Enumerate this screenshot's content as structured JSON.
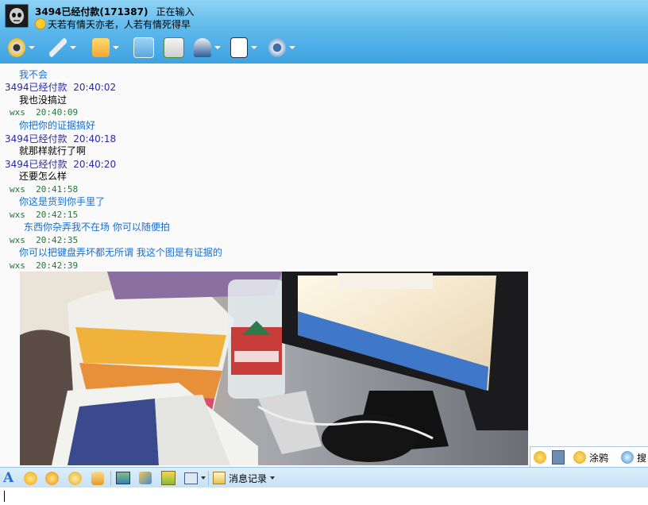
{
  "header": {
    "contact_name": "3494已经付款(171387)",
    "status": "正在输入",
    "signature": "天若有情天亦老，人若有情死得早"
  },
  "toolbar": {
    "icons": [
      "webcam-icon",
      "microphone-icon",
      "folder-transfer-icon",
      "email-icon",
      "add-contact-icon",
      "user-info-icon",
      "game-card-icon",
      "settings-icon"
    ]
  },
  "messages": [
    {
      "type": "text",
      "style": "blue",
      "text": "我不会"
    },
    {
      "type": "header",
      "sender": "3494已经付款",
      "time": "20:40:02"
    },
    {
      "type": "text",
      "style": "black",
      "text": "我也没搞过"
    },
    {
      "type": "header",
      "sender": "wxs",
      "time": "20:40:09"
    },
    {
      "type": "text",
      "style": "blue",
      "text": "你把你的证据搞好"
    },
    {
      "type": "header",
      "sender": "3494已经付款",
      "time": "20:40:18"
    },
    {
      "type": "text",
      "style": "black",
      "text": "就那样就行了啊"
    },
    {
      "type": "header",
      "sender": "3494已经付款",
      "time": "20:40:20"
    },
    {
      "type": "text",
      "style": "black",
      "text": "还要怎么样"
    },
    {
      "type": "header",
      "sender": "wxs",
      "time": "20:41:58"
    },
    {
      "type": "text",
      "style": "blue",
      "text": "你这是货到你手里了"
    },
    {
      "type": "header",
      "sender": "wxs",
      "time": "20:42:15"
    },
    {
      "type": "text",
      "style": "blue",
      "text": "东西你杂弄我不在场 你可以随便拍"
    },
    {
      "type": "header",
      "sender": "wxs",
      "time": "20:42:35"
    },
    {
      "type": "text",
      "style": "blue",
      "text": "你可以把键盘弄坏都无所谓 我这个图是有证据的"
    },
    {
      "type": "header",
      "sender": "wxs",
      "time": "20:42:39"
    }
  ],
  "side_panel": {
    "doodle_label": "涂鸦",
    "search_label": "搜"
  },
  "input_toolbar": {
    "history_label": "消息记录"
  },
  "colors": {
    "toolbar": "#4aa9e4",
    "self_name": "#2a2aa8",
    "other_name": "#1f7a3a",
    "blue_text": "#1a6fd0"
  }
}
